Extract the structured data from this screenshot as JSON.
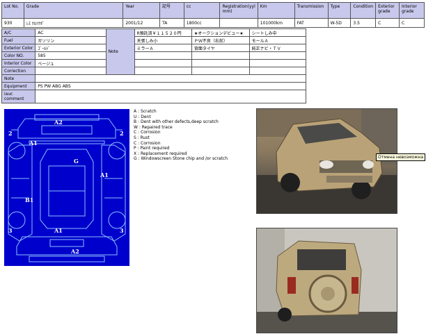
{
  "header": {
    "columns": [
      "Lot No.",
      "Grade",
      "Year",
      "記号",
      "cc",
      "Registration(yyl mm)",
      "Km",
      "Transmission",
      "Type",
      "Condition",
      "Exterior grade",
      "Interior grade"
    ],
    "values": [
      "930",
      "ﾚｽ ｸﾙﾂｸﾎﾟ",
      "2001/12",
      "TA",
      "1800cc",
      "",
      "101000km",
      "FAT",
      "W-5D",
      "3.5",
      "C",
      "C"
    ]
  },
  "details": {
    "rows": [
      {
        "label": "A/C",
        "value": "AC"
      },
      {
        "label": "Fuel",
        "value": "ガソリン"
      },
      {
        "label": "Exterior Color",
        "value": "ｺﾞｰﾙﾄﾞ"
      },
      {
        "label": "Color NO.",
        "value": "585"
      },
      {
        "label": "Interior Color",
        "value": "ベージュ"
      },
      {
        "label": "Correction",
        "value": ""
      },
      {
        "label": "Note",
        "value": ""
      },
      {
        "label": "Equipment",
        "value": "PS PW ABG ABS"
      },
      {
        "label": "iauc comment",
        "value": ""
      }
    ],
    "note_label": "Note",
    "notes": [
      [
        "R預託済￥１１５２０円",
        "★オークションデビュー★",
        "シートしみ中"
      ],
      [
        "天張しみ小",
        "ＰＷ不良（右前）",
        "モールＡ"
      ],
      [
        "ミラーＡ",
        "背面タイヤ",
        "純正ナビ・ＴＶ"
      ],
      [
        "",
        "",
        ""
      ],
      [
        "",
        "",
        ""
      ],
      [
        "",
        "",
        ""
      ]
    ]
  },
  "diagram": {
    "labels": [
      "A2",
      "A1",
      "2",
      "2",
      "G",
      "A1",
      "B1",
      "3",
      "3",
      "A1",
      "A2"
    ]
  },
  "legend": [
    "A : Scratch",
    "U : Dent",
    "B : Dent with other defects,deep scratch",
    "W : Repaired trace",
    "C : Corrosion",
    "S : Rust",
    "C : Corrosion",
    "P : Paint required",
    "X : Replacement required",
    "G : Windowscreen Stone chip and /or scratch"
  ],
  "tooltip": "Отмена невозможна"
}
